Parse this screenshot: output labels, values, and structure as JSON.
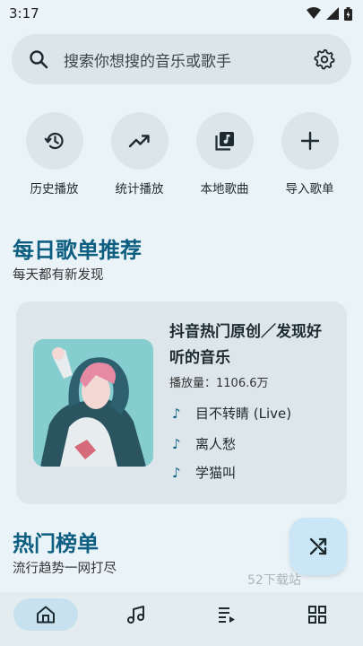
{
  "status": {
    "time": "3:17"
  },
  "search": {
    "placeholder": "搜索你想搜的音乐或歌手",
    "icon": "search-icon",
    "settings_icon": "gear-icon"
  },
  "quick_actions": [
    {
      "label": "历史播放",
      "icon": "history-icon"
    },
    {
      "label": "统计播放",
      "icon": "trending-icon"
    },
    {
      "label": "本地歌曲",
      "icon": "library-music-icon"
    },
    {
      "label": "导入歌单",
      "icon": "plus-icon"
    }
  ],
  "daily": {
    "title": "每日歌单推荐",
    "subtitle": "每天都有新发现",
    "playlist": {
      "title": "抖音热门原创／发现好听的音乐",
      "plays": "播放量：1106.6万",
      "tracks": [
        "目不转睛 (Live)",
        "离人愁",
        "学猫叫"
      ]
    }
  },
  "charts": {
    "title": "热门榜单",
    "subtitle": "流行趋势一网打尽"
  },
  "fab": {
    "icon": "shuffle-icon"
  },
  "watermark": "52下载站",
  "bottom_nav": [
    {
      "name": "home",
      "icon": "home-icon",
      "active": true
    },
    {
      "name": "music",
      "icon": "music-note-icon",
      "active": false
    },
    {
      "name": "playlist",
      "icon": "queue-icon",
      "active": false
    },
    {
      "name": "more",
      "icon": "grid-icon",
      "active": false
    }
  ],
  "colors": {
    "accent": "#0d5e80",
    "background": "#eaf4f8",
    "card": "#dde7eb"
  }
}
